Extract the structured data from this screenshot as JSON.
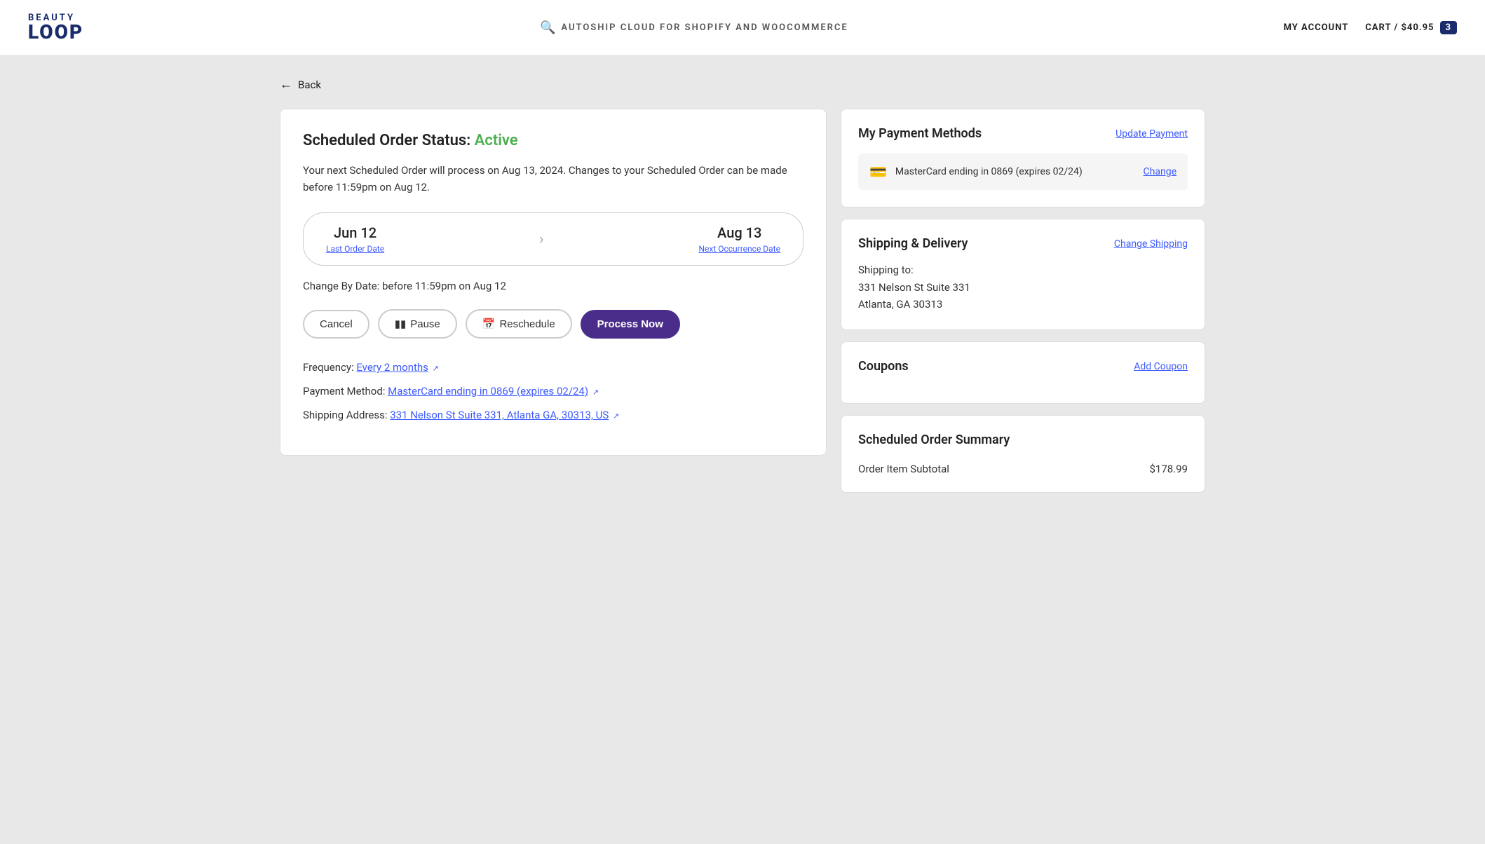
{
  "header": {
    "logo_beauty": "BEAUTY",
    "logo_loop": "LOOP",
    "search_text": "AUTOSHIP CLOUD FOR SHOPIFY AND WOOCOMMERCE",
    "my_account": "MY ACCOUNT",
    "cart_label": "CART / $40.95",
    "cart_count": "3"
  },
  "back": {
    "label": "Back"
  },
  "scheduled_order": {
    "title_prefix": "Scheduled Order Status: ",
    "status": "Active",
    "description": "Your next Scheduled Order will process on Aug 13, 2024. Changes to your Scheduled Order can be made before 11:59pm on Aug 12.",
    "last_order_date": "Jun 12",
    "last_order_label": "Last Order Date",
    "next_occurrence_date": "Aug 13",
    "next_occurrence_label": "Next Occurrence Date",
    "change_by_date": "Change By Date: before 11:59pm on Aug 12",
    "btn_cancel": "Cancel",
    "btn_pause": "Pause",
    "btn_reschedule": "Reschedule",
    "btn_process_now": "Process Now",
    "frequency_prefix": "Frequency: ",
    "frequency_link": "Every 2 months",
    "payment_prefix": "Payment Method: ",
    "payment_link": "MasterCard ending in 0869 (expires 02/24)",
    "shipping_prefix": "Shipping Address: ",
    "shipping_link": "331 Nelson St Suite 331, Atlanta GA, 30313, US"
  },
  "payment_methods": {
    "title": "My Payment Methods",
    "update_link": "Update Payment",
    "card_info": "MasterCard ending in 0869 (expires 02/24)",
    "change_link": "Change"
  },
  "shipping": {
    "title": "Shipping & Delivery",
    "change_link": "Change Shipping",
    "shipping_to": "Shipping to:",
    "address_line1": "331 Nelson St Suite 331",
    "address_line2": "Atlanta, GA 30313"
  },
  "coupons": {
    "title": "Coupons",
    "add_link": "Add Coupon"
  },
  "order_summary": {
    "title": "Scheduled Order Summary",
    "subtotal_label": "Order Item Subtotal",
    "subtotal_value": "$178.99"
  }
}
